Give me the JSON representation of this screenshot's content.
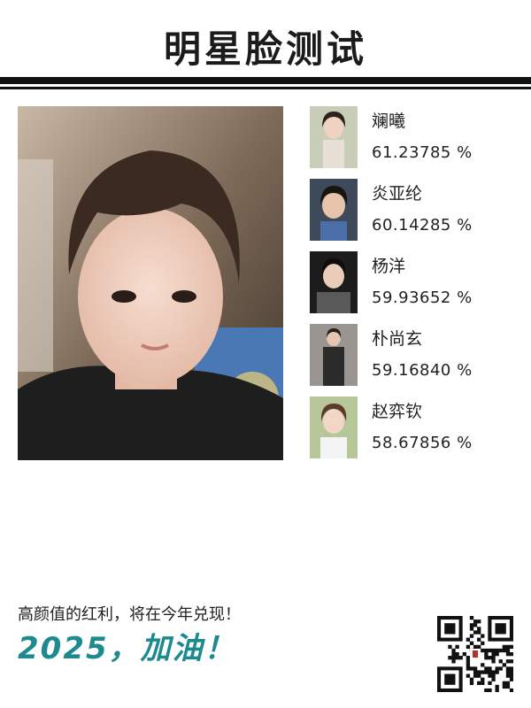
{
  "header": {
    "title": "明星脸测试"
  },
  "main_photo": {
    "alt": "user portrait"
  },
  "matches": [
    {
      "name": "斓曦",
      "percent": "61.23785 %"
    },
    {
      "name": "炎亚纶",
      "percent": "60.14285 %"
    },
    {
      "name": "杨洋",
      "percent": "59.93652 %"
    },
    {
      "name": "朴尚玄",
      "percent": "59.16840 %"
    },
    {
      "name": "赵弈钦",
      "percent": "58.67856 %"
    }
  ],
  "footer": {
    "slogan": "高颜值的红利，将在今年兑现！",
    "cheer": "2025，加油！"
  },
  "colors": {
    "accent": "#1d8a8f",
    "rule": "#111111"
  }
}
